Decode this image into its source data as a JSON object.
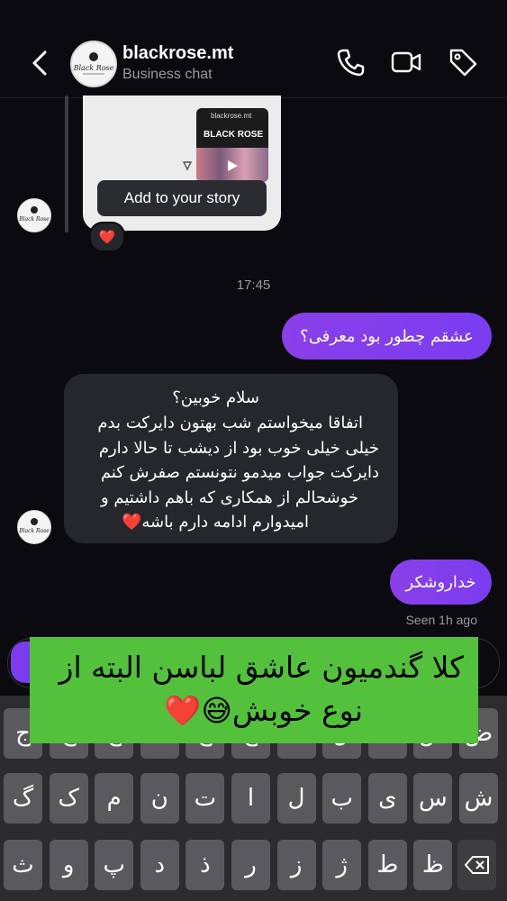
{
  "header": {
    "name": "blackrose.mt",
    "subtitle": "Business chat",
    "avatar_text": "Black Rose",
    "icons": [
      "back-arrow-icon",
      "phone-icon",
      "video-icon",
      "tag-icon"
    ]
  },
  "story_card": {
    "preview_label": "blackrose.mt",
    "preview_sign": "BLACK ROSE",
    "add_to_story": "Add to your story",
    "reaction": "❤️"
  },
  "timestamp": "17:45",
  "messages": [
    {
      "from": "me",
      "text": "عشقم چطور بود معرفی؟"
    },
    {
      "from": "them",
      "lines": [
        "سلام خوبین؟",
        "اتفاقا میخواستم شب بهتون دایرکت بدم",
        "خیلی خیلی خوب بود از دیشب تا حالا دارم",
        "دایرکت جواب میدمو نتونستم صفرش کنم",
        "خوشحالم از همکاری که باهم داشتیم و",
        "امیدوارم ادامه دارم باشه❤️"
      ]
    },
    {
      "from": "me",
      "text": "خداروشکر"
    }
  ],
  "seen": "Seen 1h ago",
  "overlay": {
    "line1": "کلا گندمیون عاشق لباسن البته از",
    "line2": "نوع خوبش😅❤️"
  },
  "keyboard": {
    "row1": [
      "ض",
      "ص",
      "ث",
      "ق",
      "ف",
      "غ",
      "ع",
      "ه",
      "خ",
      "ح",
      "ج"
    ],
    "row2": [
      "ش",
      "س",
      "ی",
      "ب",
      "ل",
      "ا",
      "ت",
      "ن",
      "م",
      "ک",
      "گ"
    ],
    "row3": [
      "ظ",
      "ط",
      "ژ",
      "ز",
      "ر",
      "ذ",
      "د",
      "پ",
      "و",
      "ث"
    ],
    "delete_icon": "backspace-icon"
  }
}
